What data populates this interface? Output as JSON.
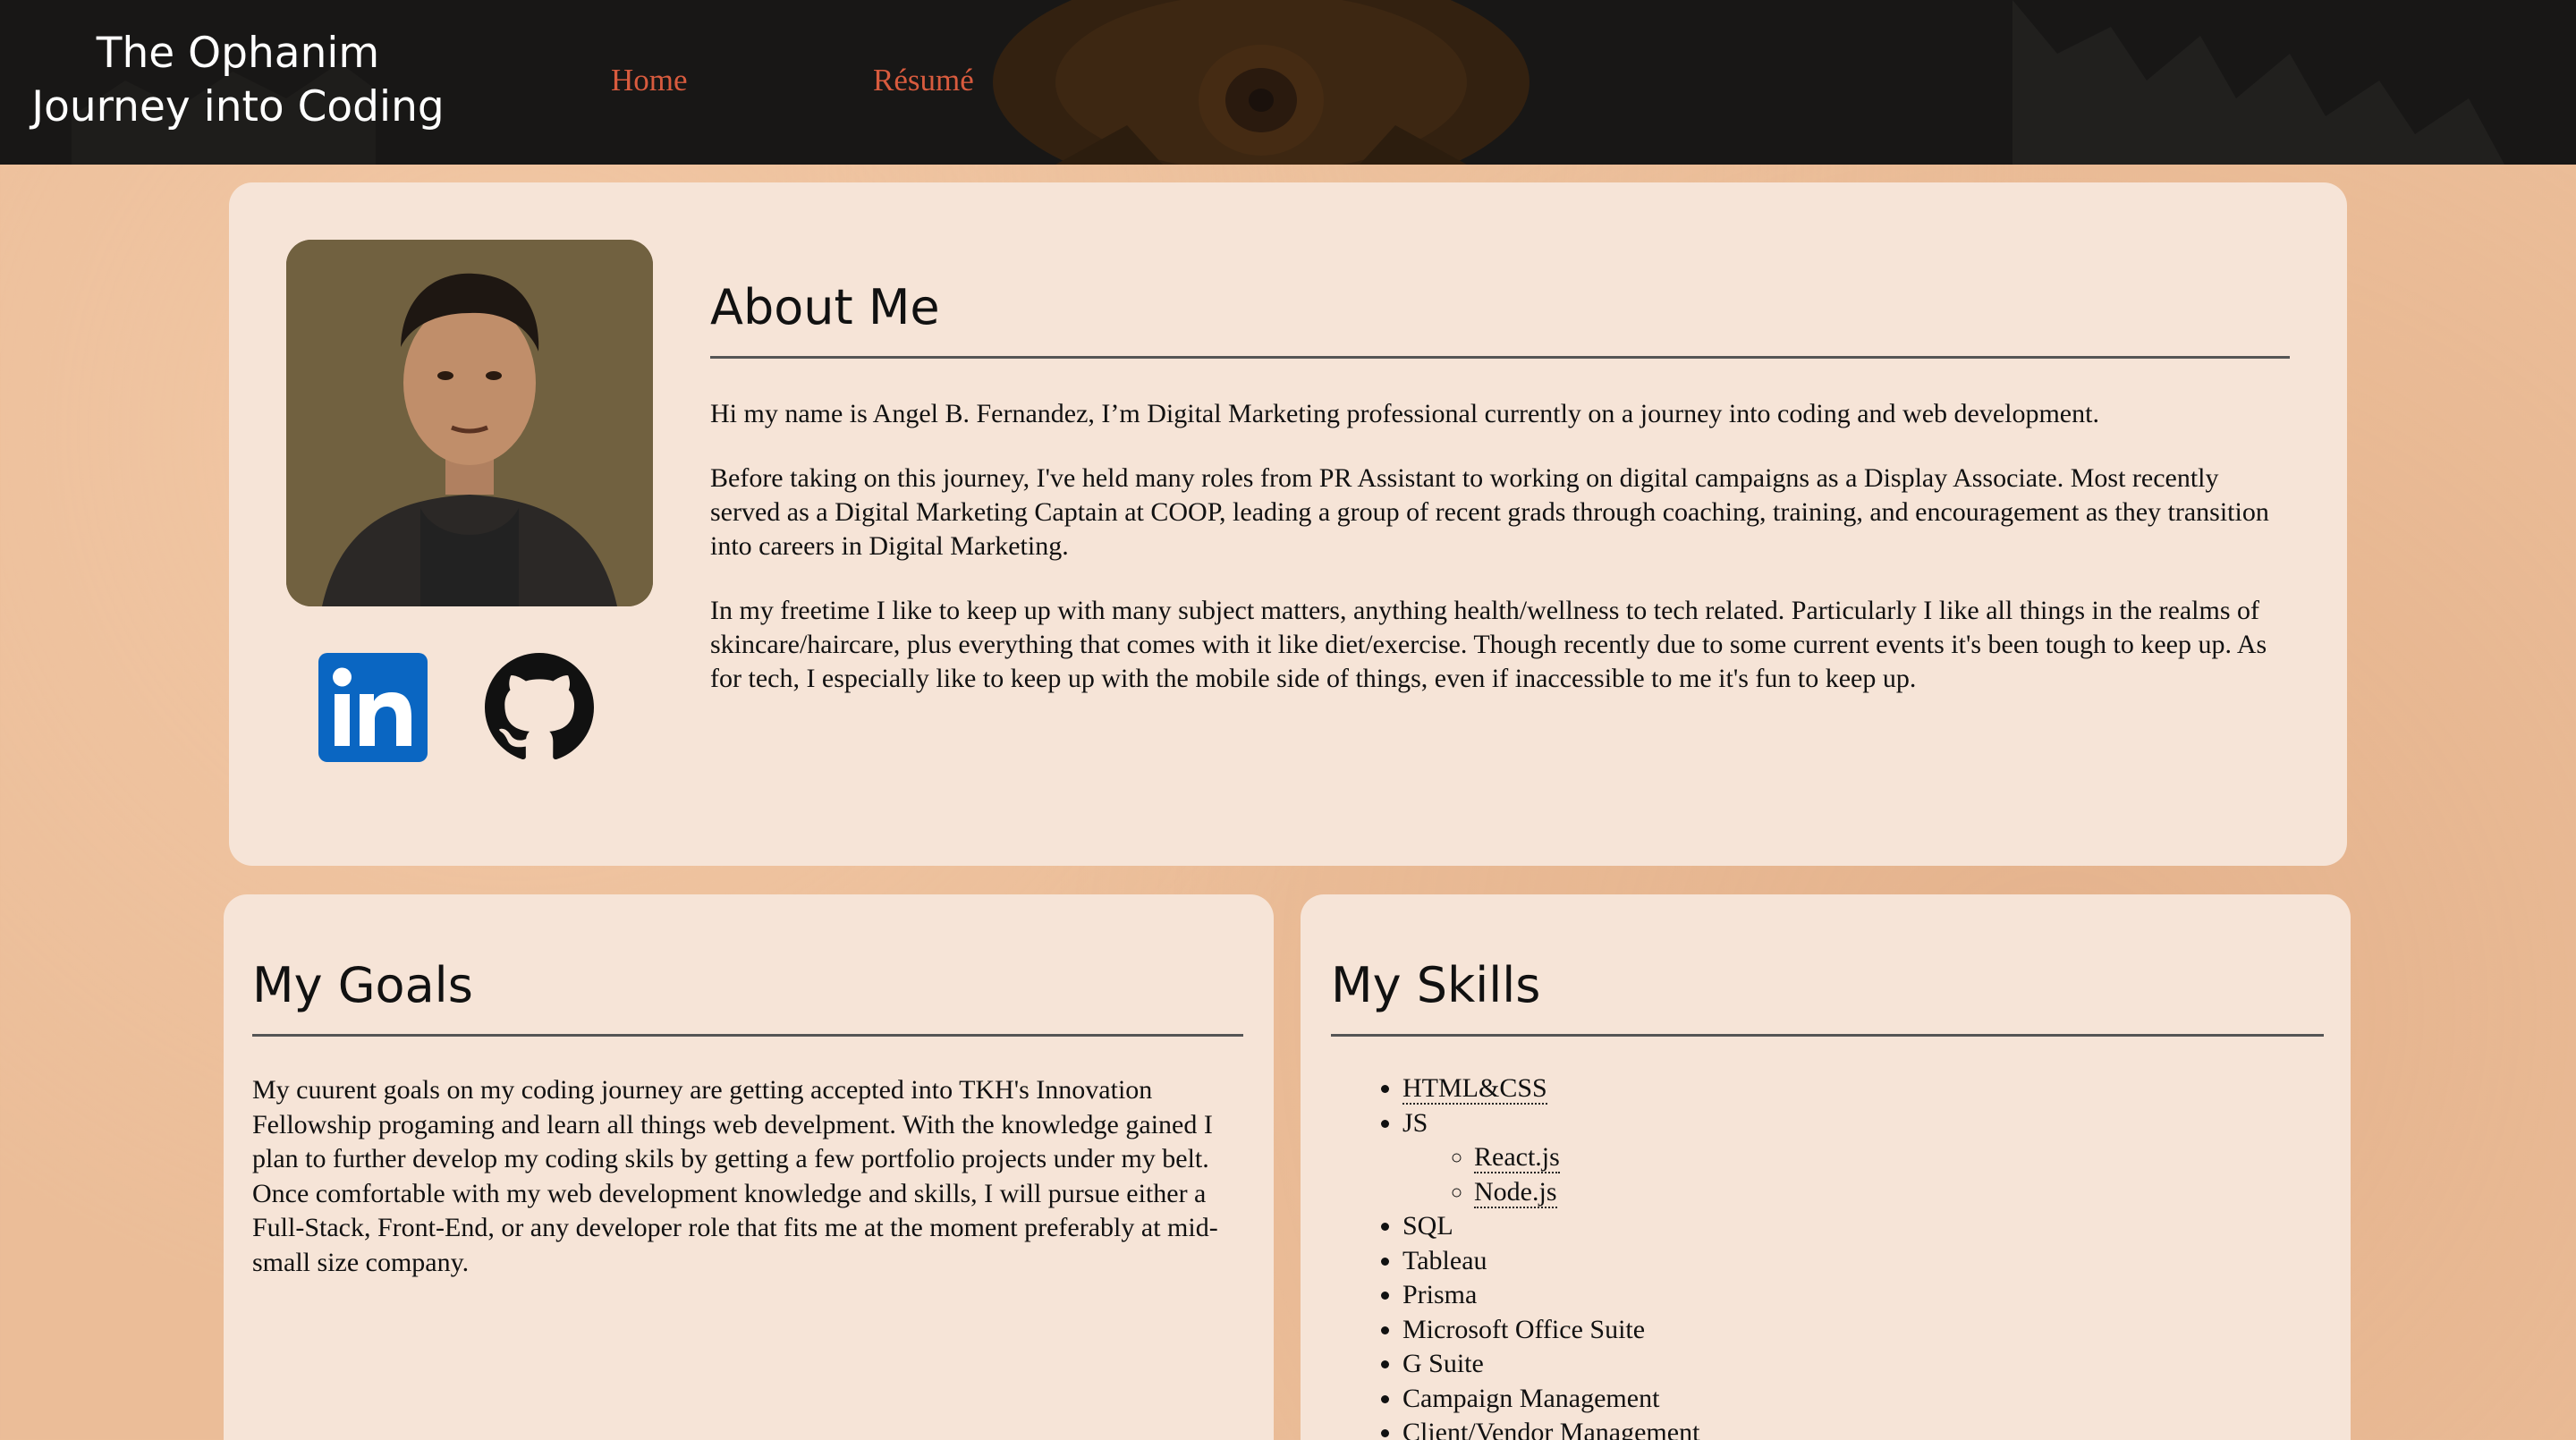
{
  "header": {
    "brand_line1": "The Ophanim",
    "brand_line2": "Journey into Coding",
    "nav": {
      "home": "Home",
      "resume": "Résumé"
    },
    "colors": {
      "background": "#181716",
      "nav_link": "#d85b3e",
      "brand_text": "#ffffff"
    }
  },
  "about": {
    "title": "About Me",
    "paragraphs": [
      "Hi my name is Angel B. Fernandez, I’m Digital Marketing professional currently on a journey into coding and web development.",
      "Before taking on this journey, I've held many roles from PR Assistant to working on digital campaigns as a Display Associate. Most recently served as a Digital Marketing Captain at COOP, leading a group of recent grads through coaching, training, and encouragement as they transition into careers in Digital Marketing.",
      "In my freetime I like to keep up with many subject matters, anything health/wellness to tech related. Particularly I like all things in the realms of skincare/haircare, plus everything that comes with it like diet/exercise. Though recently due to some current events it's been tough to keep up. As for tech, I especially like to keep up with the mobile side of things, even if inaccessible to me it's fun to keep up."
    ],
    "social": {
      "linkedin_icon": "linkedin-icon",
      "github_icon": "github-icon",
      "linkedin_color": "#0a66c2"
    }
  },
  "goals": {
    "title": "My Goals",
    "text": "My cuurent goals on my coding journey are getting accepted into TKH's Innovation Fellowship progaming and learn all things web develpment. With the knowledge gained I plan to further develop my coding skils by getting a few portfolio projects under my belt. Once comfortable with my web development knowledge and skills, I will pursue either a Full-Stack, Front-End, or any developer role that fits me at the moment preferably at mid-small size company."
  },
  "skills": {
    "title": "My Skills",
    "items": [
      {
        "label": "HTML&CSS"
      },
      {
        "label": "JS",
        "sub": [
          "React.js",
          "Node.js"
        ]
      },
      {
        "label": "SQL"
      },
      {
        "label": "Tableau"
      },
      {
        "label": "Prisma"
      },
      {
        "label": "Microsoft Office Suite"
      },
      {
        "label": "G Suite"
      },
      {
        "label": "Campaign Management"
      },
      {
        "label": "Client/Vendor Management"
      }
    ]
  },
  "colors": {
    "page_background": "#ebbd98",
    "card_background": "#f6e4d7"
  }
}
